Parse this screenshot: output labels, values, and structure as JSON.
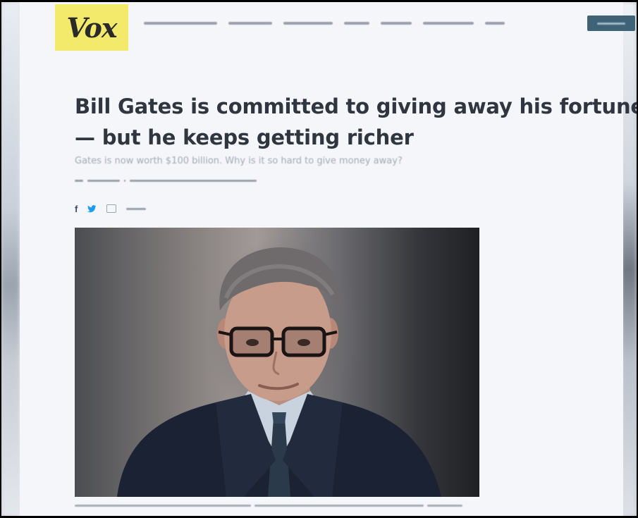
{
  "header": {
    "logo_text": "Vox",
    "logo_color": "#f3e96a"
  },
  "article": {
    "headline_line1": "Bill Gates is committed to giving away his fortune",
    "headline_line2": "— but he keeps getting richer",
    "subhead": "Gates is now worth $100 billion. Why is it so hard to give money away?"
  },
  "icons": {
    "facebook": "facebook-icon",
    "twitter": "twitter-icon",
    "comment": "comment-icon"
  },
  "colors": {
    "accent": "#3f6277",
    "headline": "#30363f",
    "twitter": "#1d9bf0"
  }
}
